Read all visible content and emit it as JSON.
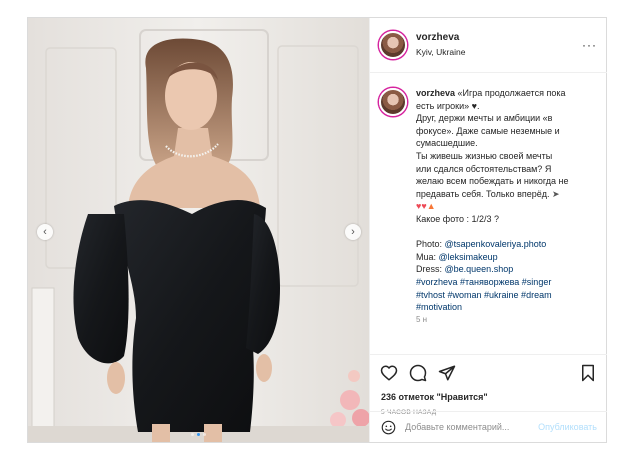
{
  "post": {
    "author": {
      "username": "vorzheva",
      "location": "Kyiv, Ukraine"
    },
    "media": {
      "prev_icon": "chevron-left-icon",
      "next_icon": "chevron-right-icon",
      "slides": 3,
      "current_slide": 2
    },
    "caption": {
      "username": "vorzheva",
      "lines": [
        "«Игра продолжается пока",
        "есть игроки»",
        "Друг, держи мечты и амбиции «в",
        "фокусе». Даже самые неземные и",
        "сумасшедшие.",
        "Ты живешь жизнью своей мечты",
        "или сдался обстоятельствам? Я",
        "желаю всем побеждать и никогда не",
        "предавать себя. Только вперёд.",
        "Какое фото : 1/2/3 ?"
      ],
      "credits": {
        "photo_label": "Photo: ",
        "photo_handle": "@tsapenkovaleriya.photo",
        "mua_label": "Mua: ",
        "mua_handle": "@leksimakeup",
        "dress_label": "Dress: ",
        "dress_handle": "@be.queen.shop"
      },
      "hashtags": [
        "#vorzheva #таняворжева #singer",
        "#tvhost #woman #ukraine #dream",
        "#motivation"
      ],
      "truncated": "5 н"
    },
    "actions": {
      "like_icon": "heart-icon",
      "comment_icon": "comment-icon",
      "share_icon": "paper-plane-icon",
      "save_icon": "bookmark-icon"
    },
    "likes_text": "236 отметок \"Нравится\"",
    "time_text": "5 ЧАСОВ НАЗАД",
    "comment": {
      "placeholder": "Добавьте комментарий...",
      "value": "",
      "publish_label": "Опубликовать",
      "emoji_icon": "smiley-icon"
    }
  },
  "colors": {
    "link": "#00376b",
    "publish_disabled": "#b2dffc",
    "meta_grey": "#8e8e8e",
    "dress_black": "#17191c",
    "avatar_ring": "#d6249f"
  }
}
